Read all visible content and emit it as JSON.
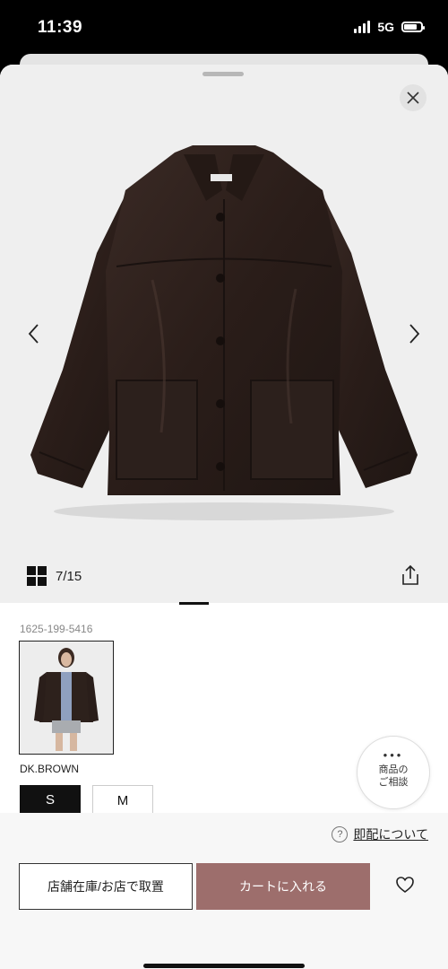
{
  "status": {
    "time": "11:39",
    "network": "5G"
  },
  "gallery": {
    "counter": "7/15",
    "current": 7,
    "total": 15
  },
  "product": {
    "sku": "1625-199-5416",
    "color_name": "DK.BROWN",
    "sizes": [
      {
        "label": "S",
        "selected": true
      },
      {
        "label": "M",
        "selected": false
      }
    ]
  },
  "consult": {
    "line1": "商品の",
    "line2": "ご相談"
  },
  "footer": {
    "delivery_link": "即配について",
    "store_button": "店舗在庫/お店で取置",
    "cart_button": "カートに入れる"
  },
  "colors": {
    "cart_button": "#9d6e6c",
    "gallery_bg": "#efefef",
    "jacket": "#2e211d"
  },
  "icons": {
    "close": "close-icon",
    "prev": "chevron-left-icon",
    "next": "chevron-right-icon",
    "grid": "grid-icon",
    "share": "share-icon",
    "help": "help-icon",
    "favorite": "heart-icon"
  }
}
